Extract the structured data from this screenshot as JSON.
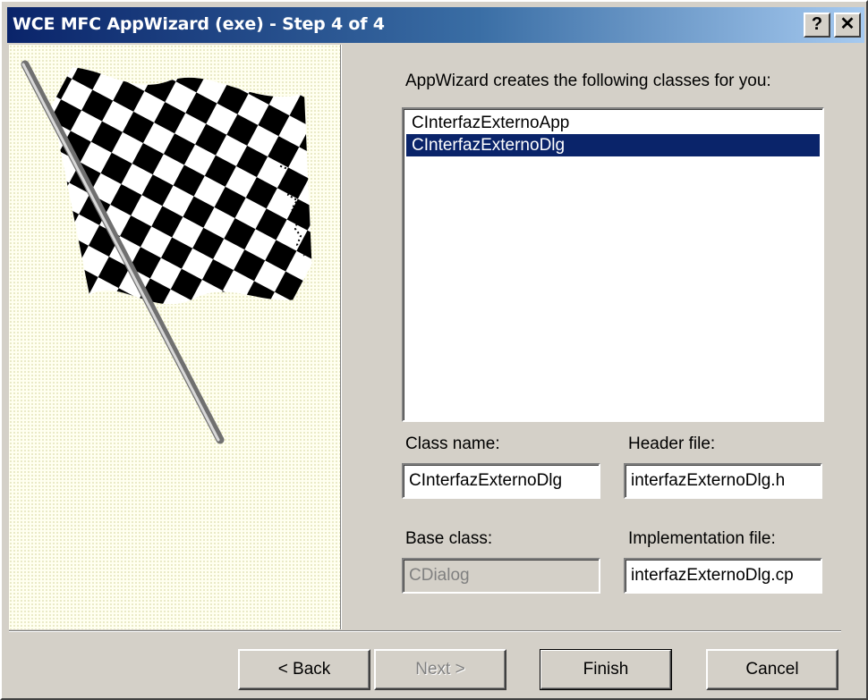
{
  "window": {
    "title": "WCE MFC AppWizard (exe) - Step 4 of 4",
    "help_glyph": "?",
    "close_glyph": "✕"
  },
  "art": {
    "icon": "checkered-flag-icon"
  },
  "classes": {
    "heading": "AppWizard creates the following classes for you:",
    "items": [
      "CInterfazExternoApp",
      "CInterfazExternoDlg"
    ],
    "selected_index": 1
  },
  "form": {
    "class_name_label": "Class name:",
    "class_name_value": "CInterfazExternoDlg",
    "header_file_label": "Header file:",
    "header_file_value": "interfazExternoDlg.h",
    "base_class_label": "Base class:",
    "base_class_value": "CDialog",
    "impl_file_label": "Implementation file:",
    "impl_file_value": "interfazExternoDlg.cp"
  },
  "buttons": {
    "back": "< Back",
    "next": "Next >",
    "finish": "Finish",
    "cancel": "Cancel"
  },
  "colors": {
    "titlebar_start": "#0a246a",
    "titlebar_end": "#a6caf0",
    "selection": "#0a246a",
    "face": "#d4d0c8"
  }
}
